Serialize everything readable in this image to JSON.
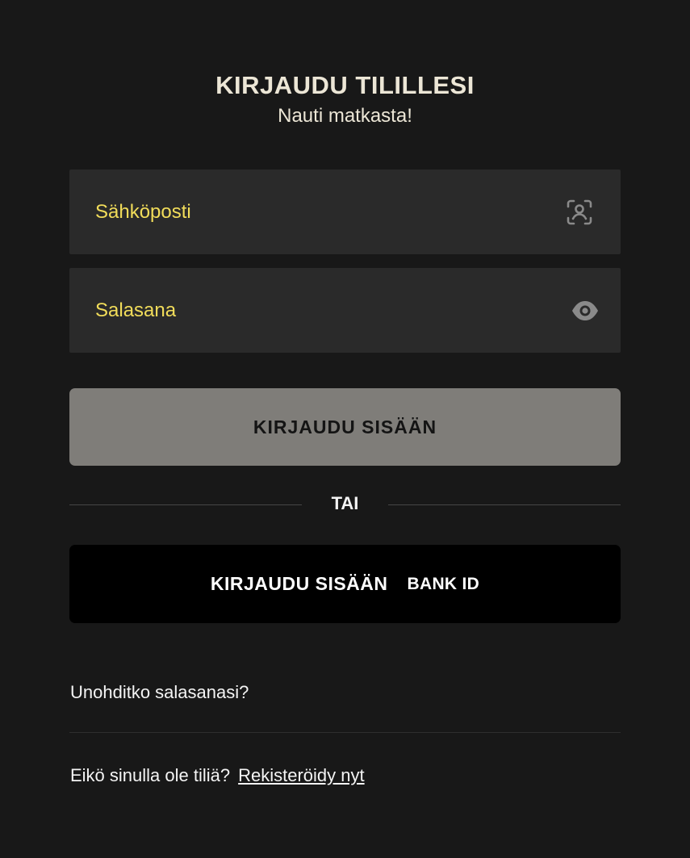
{
  "header": {
    "title": "KIRJAUDU TILILLESI",
    "subtitle": "Nauti matkasta!"
  },
  "form": {
    "email_label": "Sähköposti",
    "email_icon": "face-id-icon",
    "password_label": "Salasana",
    "password_icon": "eye-icon",
    "login_button": "KIRJAUDU SISÄÄN",
    "divider": "TAI",
    "bankid_button": "KIRJAUDU SISÄÄN",
    "bankid_logo": "BANK ID"
  },
  "footer": {
    "forgot_password": "Unohditko salasanasi?",
    "no_account": "Eikö sinulla ole tiliä?",
    "register_link": "Rekisteröidy nyt"
  },
  "colors": {
    "background": "#181818",
    "field_bg": "#2a2a2a",
    "label_accent": "#f2dd5a",
    "login_button_bg": "#7f7d79",
    "bankid_button_bg": "#000000"
  }
}
